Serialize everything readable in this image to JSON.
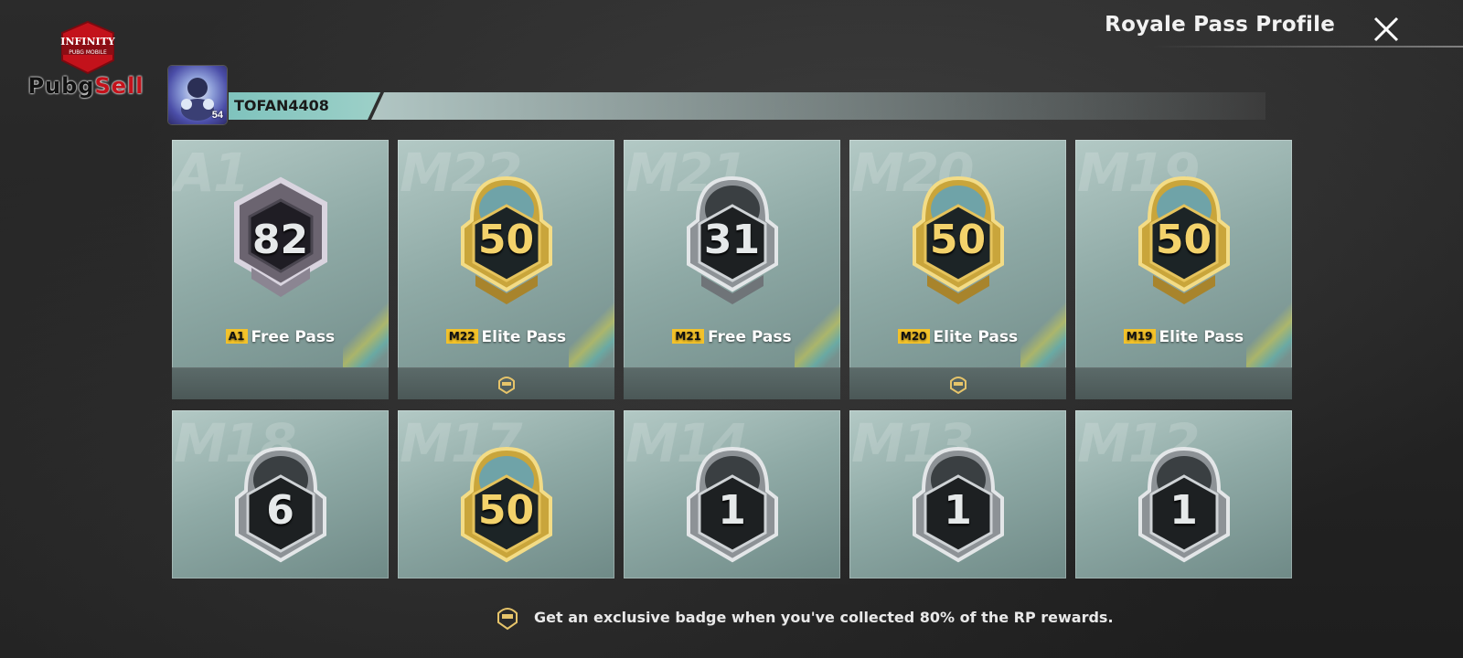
{
  "watermark": {
    "shield_text_1": "INFINITY",
    "shield_text_2": "PUBG MOBILE",
    "brand_part1": "Pubg",
    "brand_part2": "Sell"
  },
  "header": {
    "title": "Royale Pass Profile",
    "close_icon": "close-icon"
  },
  "player": {
    "name": "TOFAN4408",
    "level": "54"
  },
  "cards": [
    {
      "season": "A1",
      "badge": "82",
      "tier": "silver",
      "season_tag": "A1",
      "pass": "Free Pass",
      "elite_icon": false
    },
    {
      "season": "M22",
      "badge": "50",
      "tier": "gold",
      "season_tag": "M22",
      "pass": "Elite Pass",
      "elite_icon": true
    },
    {
      "season": "M21",
      "badge": "31",
      "tier": "silver",
      "season_tag": "M21",
      "pass": "Free Pass",
      "elite_icon": false
    },
    {
      "season": "M20",
      "badge": "50",
      "tier": "gold",
      "season_tag": "M20",
      "pass": "Elite Pass",
      "elite_icon": true
    },
    {
      "season": "M19",
      "badge": "50",
      "tier": "gold",
      "season_tag": "M19",
      "pass": "Elite Pass",
      "elite_icon": false
    },
    {
      "season": "M18",
      "badge": "6",
      "tier": "silver"
    },
    {
      "season": "M17",
      "badge": "50",
      "tier": "gold"
    },
    {
      "season": "M14",
      "badge": "1",
      "tier": "silver"
    },
    {
      "season": "M13",
      "badge": "1",
      "tier": "silver"
    },
    {
      "season": "M12",
      "badge": "1",
      "tier": "silver"
    }
  ],
  "footer_note": {
    "icon": "rp-badge-icon",
    "text": "Get an exclusive badge when you've collected 80% of the RP rewards."
  },
  "colors": {
    "gold": "#f3d26b",
    "silver": "#e6e9ea",
    "accent_teal": "#7fc3bd",
    "season_tag": "#f3c22a"
  }
}
